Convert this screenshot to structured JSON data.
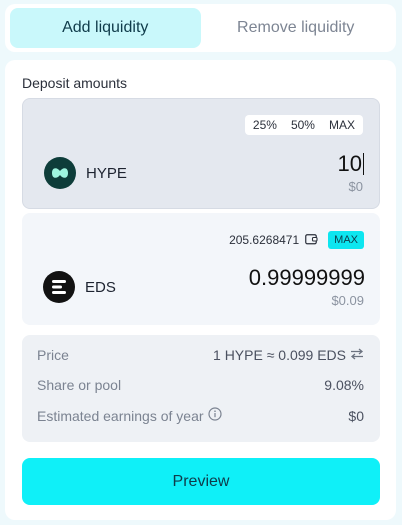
{
  "tabs": [
    {
      "label": "Add liquidity",
      "active": true
    },
    {
      "label": "Remove liquidity",
      "active": false
    }
  ],
  "deposit_title": "Deposit amounts",
  "token_a": {
    "symbol": "HYPE",
    "icon": "hype-logo-icon",
    "percent_buttons": [
      "25%",
      "50%",
      "MAX"
    ],
    "amount": "10",
    "usd_value": "$0"
  },
  "token_b": {
    "symbol": "EDS",
    "icon": "eds-logo-icon",
    "balance": "205.6268471",
    "max_label": "MAX",
    "amount": "0.99999999",
    "usd_value": "$0.09"
  },
  "info": {
    "price_label": "Price",
    "price_value": "1 HYPE ≈ 0.099 EDS",
    "share_label": "Share or pool",
    "share_value": "9.08%",
    "earnings_label": "Estimated earnings of year",
    "earnings_value": "$0"
  },
  "preview_label": "Preview",
  "colors": {
    "accent": "#0ff0f8",
    "active_tab": "#c9f8fb",
    "background": "#eef9fc"
  }
}
